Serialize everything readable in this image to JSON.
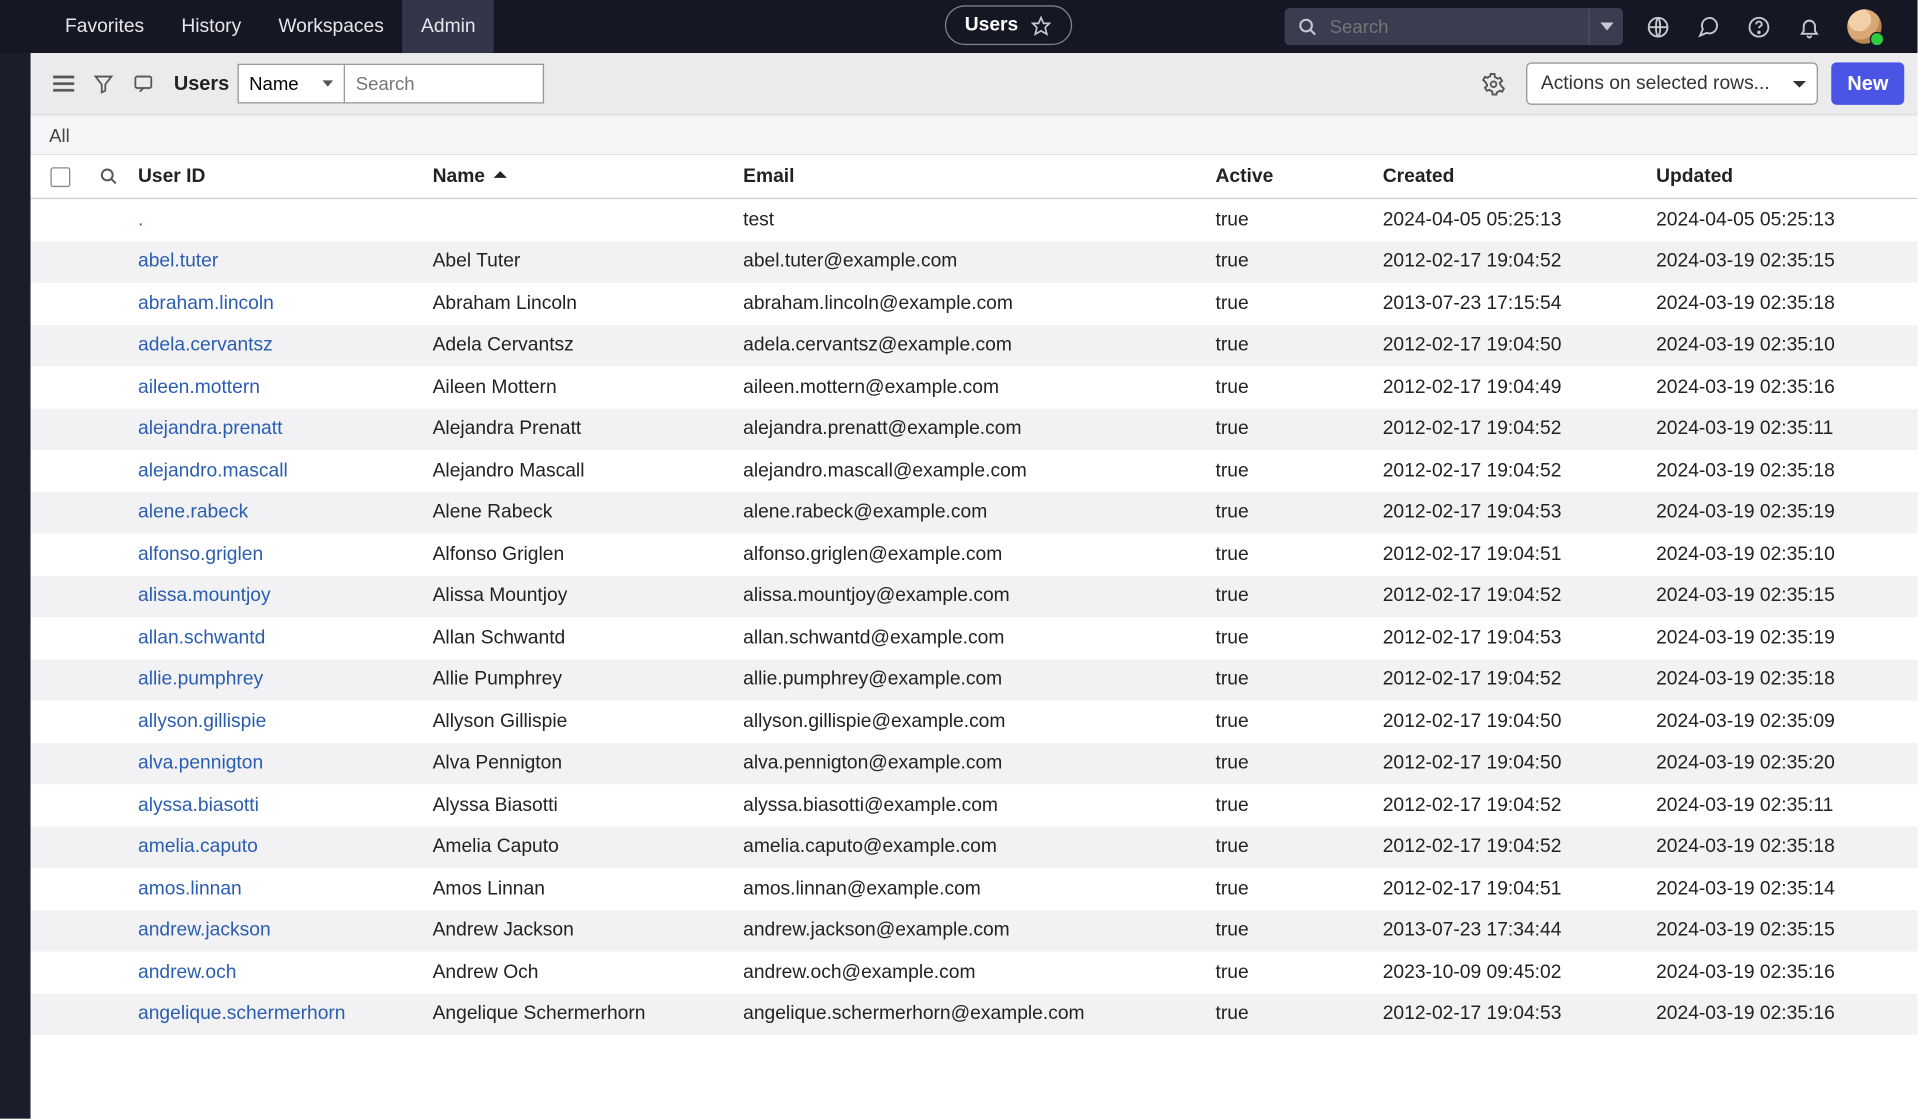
{
  "nav": {
    "tabs": [
      "Favorites",
      "History",
      "Workspaces",
      "Admin"
    ],
    "active": 3
  },
  "breadcrumb": {
    "label": "Users"
  },
  "globalSearch": {
    "placeholder": "Search"
  },
  "toolbar": {
    "title": "Users",
    "searchBy": "Name",
    "searchPlaceholder": "Search",
    "actionsLabel": "Actions on selected rows...",
    "newLabel": "New"
  },
  "filter": {
    "all": "All"
  },
  "columns": {
    "userId": "User ID",
    "name": "Name",
    "email": "Email",
    "active": "Active",
    "created": "Created",
    "updated": "Updated"
  },
  "rows": [
    {
      "uid": ".",
      "name": "",
      "email": "test",
      "active": "true",
      "created": "2024-04-05 05:25:13",
      "updated": "2024-04-05 05:25:13"
    },
    {
      "uid": "abel.tuter",
      "name": "Abel Tuter",
      "email": "abel.tuter@example.com",
      "active": "true",
      "created": "2012-02-17 19:04:52",
      "updated": "2024-03-19 02:35:15"
    },
    {
      "uid": "abraham.lincoln",
      "name": "Abraham Lincoln",
      "email": "abraham.lincoln@example.com",
      "active": "true",
      "created": "2013-07-23 17:15:54",
      "updated": "2024-03-19 02:35:18"
    },
    {
      "uid": "adela.cervantsz",
      "name": "Adela Cervantsz",
      "email": "adela.cervantsz@example.com",
      "active": "true",
      "created": "2012-02-17 19:04:50",
      "updated": "2024-03-19 02:35:10"
    },
    {
      "uid": "aileen.mottern",
      "name": "Aileen Mottern",
      "email": "aileen.mottern@example.com",
      "active": "true",
      "created": "2012-02-17 19:04:49",
      "updated": "2024-03-19 02:35:16"
    },
    {
      "uid": "alejandra.prenatt",
      "name": "Alejandra Prenatt",
      "email": "alejandra.prenatt@example.com",
      "active": "true",
      "created": "2012-02-17 19:04:52",
      "updated": "2024-03-19 02:35:11"
    },
    {
      "uid": "alejandro.mascall",
      "name": "Alejandro Mascall",
      "email": "alejandro.mascall@example.com",
      "active": "true",
      "created": "2012-02-17 19:04:52",
      "updated": "2024-03-19 02:35:18"
    },
    {
      "uid": "alene.rabeck",
      "name": "Alene Rabeck",
      "email": "alene.rabeck@example.com",
      "active": "true",
      "created": "2012-02-17 19:04:53",
      "updated": "2024-03-19 02:35:19"
    },
    {
      "uid": "alfonso.griglen",
      "name": "Alfonso Griglen",
      "email": "alfonso.griglen@example.com",
      "active": "true",
      "created": "2012-02-17 19:04:51",
      "updated": "2024-03-19 02:35:10"
    },
    {
      "uid": "alissa.mountjoy",
      "name": "Alissa Mountjoy",
      "email": "alissa.mountjoy@example.com",
      "active": "true",
      "created": "2012-02-17 19:04:52",
      "updated": "2024-03-19 02:35:15"
    },
    {
      "uid": "allan.schwantd",
      "name": "Allan Schwantd",
      "email": "allan.schwantd@example.com",
      "active": "true",
      "created": "2012-02-17 19:04:53",
      "updated": "2024-03-19 02:35:19"
    },
    {
      "uid": "allie.pumphrey",
      "name": "Allie Pumphrey",
      "email": "allie.pumphrey@example.com",
      "active": "true",
      "created": "2012-02-17 19:04:52",
      "updated": "2024-03-19 02:35:18"
    },
    {
      "uid": "allyson.gillispie",
      "name": "Allyson Gillispie",
      "email": "allyson.gillispie@example.com",
      "active": "true",
      "created": "2012-02-17 19:04:50",
      "updated": "2024-03-19 02:35:09"
    },
    {
      "uid": "alva.pennigton",
      "name": "Alva Pennigton",
      "email": "alva.pennigton@example.com",
      "active": "true",
      "created": "2012-02-17 19:04:50",
      "updated": "2024-03-19 02:35:20"
    },
    {
      "uid": "alyssa.biasotti",
      "name": "Alyssa Biasotti",
      "email": "alyssa.biasotti@example.com",
      "active": "true",
      "created": "2012-02-17 19:04:52",
      "updated": "2024-03-19 02:35:11"
    },
    {
      "uid": "amelia.caputo",
      "name": "Amelia Caputo",
      "email": "amelia.caputo@example.com",
      "active": "true",
      "created": "2012-02-17 19:04:52",
      "updated": "2024-03-19 02:35:18"
    },
    {
      "uid": "amos.linnan",
      "name": "Amos Linnan",
      "email": "amos.linnan@example.com",
      "active": "true",
      "created": "2012-02-17 19:04:51",
      "updated": "2024-03-19 02:35:14"
    },
    {
      "uid": "andrew.jackson",
      "name": "Andrew Jackson",
      "email": "andrew.jackson@example.com",
      "active": "true",
      "created": "2013-07-23 17:34:44",
      "updated": "2024-03-19 02:35:15"
    },
    {
      "uid": "andrew.och",
      "name": "Andrew Och",
      "email": "andrew.och@example.com",
      "active": "true",
      "created": "2023-10-09 09:45:02",
      "updated": "2024-03-19 02:35:16"
    },
    {
      "uid": "angelique.schermerhorn",
      "name": "Angelique Schermerhorn",
      "email": "angelique.schermerhorn@example.com",
      "active": "true",
      "created": "2012-02-17 19:04:53",
      "updated": "2024-03-19 02:35:16"
    }
  ]
}
